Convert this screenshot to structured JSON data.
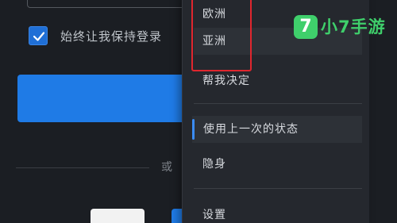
{
  "login": {
    "remember_label": "始终让我保持登录",
    "or_label": "或"
  },
  "menu": {
    "items": [
      {
        "label": "欧洲"
      },
      {
        "label": "亚洲"
      },
      {
        "label": "帮我决定"
      },
      {
        "label": "使用上一次的状态"
      },
      {
        "label": "隐身"
      },
      {
        "label": "设置"
      }
    ]
  },
  "watermark": {
    "badge": "7",
    "text": "小7手游"
  },
  "colors": {
    "accent": "#1f7be6",
    "highlight_box": "#e0262e",
    "logo": "#3fcf6b"
  }
}
